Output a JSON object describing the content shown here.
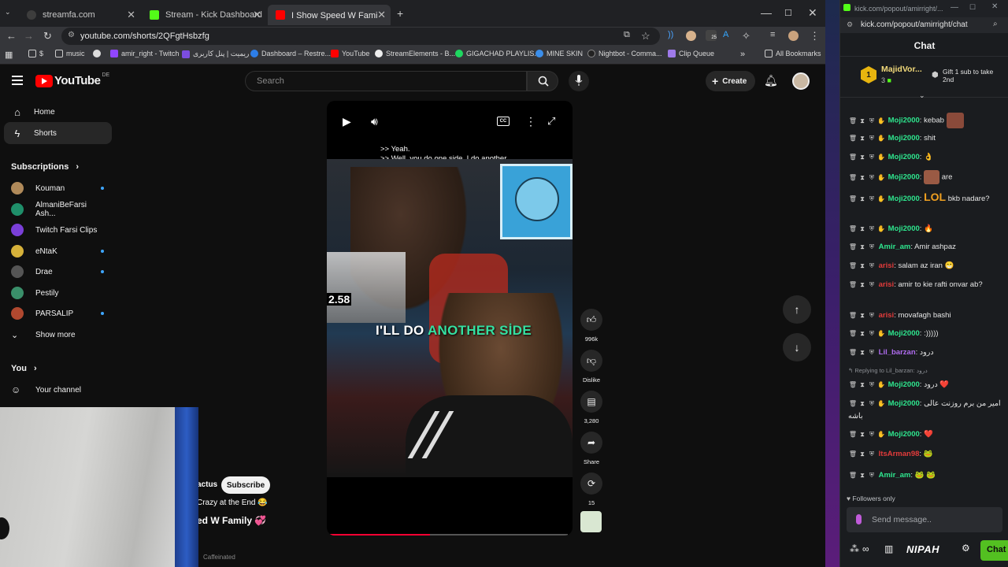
{
  "browser": {
    "tabs": [
      {
        "title": "streamfa.com",
        "color": "#3d3d3d"
      },
      {
        "title": "Stream - Kick Dashboard",
        "color": "#53fc18"
      },
      {
        "title": "I Show Speed W Family 💞 - Yo",
        "color": "#ff0000"
      }
    ],
    "new_tab": "+",
    "url": "youtube.com/shorts/2QFgtHsbzfg",
    "bookmarks": [
      "$",
      "music",
      "amir_right - Twitch",
      "ریمیت | پنل کاربری",
      "Dashboard – Restre...",
      "YouTube",
      "StreamElements - B...",
      "GIGACHAD PLAYLIS...",
      "MINE SKIN",
      "Nightbot - Comma...",
      "Clip Queue"
    ],
    "all_bookmarks": "All Bookmarks",
    "extension_badge": "25"
  },
  "youtube": {
    "logo_text": "YouTube",
    "country": "DE",
    "search_placeholder": "Search",
    "create_label": "Create",
    "sidebar": {
      "home": "Home",
      "shorts": "Shorts",
      "subscriptions_header": "Subscriptions",
      "subscriptions": [
        {
          "name": "Kouman",
          "color": "#b08a5a",
          "dot": true
        },
        {
          "name": "AlmaniBeFarsi Ash...",
          "color": "#1f8f6a",
          "dot": false
        },
        {
          "name": "Twitch Farsi Clips",
          "color": "#7a3fd8",
          "dot": false
        },
        {
          "name": "eNtaK",
          "color": "#d6b13a",
          "dot": true
        },
        {
          "name": "Drae",
          "color": "#555555",
          "dot": true
        },
        {
          "name": "Pestily",
          "color": "#3a8f6a",
          "dot": false
        },
        {
          "name": "PARSALIP",
          "color": "#b0482f",
          "dot": true
        }
      ],
      "show_more": "Show more",
      "you_header": "You",
      "your_channel": "Your channel"
    },
    "short": {
      "subtitle_line1": ">> Yeah.",
      "subtitle_line2": ">> Well, you do one side, I do another",
      "caption_white": "I'LL DO",
      "caption_green": "ANOTHER SİDE",
      "inset_number": "2.58",
      "progress": 0.42,
      "channel_fragment": "actus",
      "subscribe_label": "Subscribe",
      "desc_line": "Crazy at the End 😂",
      "title_fragment": "ed W Family 💞",
      "footer_text": "Caffeinated"
    },
    "actions": {
      "likes": "996k",
      "dislike": "Dislike",
      "comments": "3,280",
      "share": "Share",
      "remix": "15"
    }
  },
  "kick_popout": {
    "window_title": "kick.com/popout/amirright/...",
    "url": "kick.com/popout/amirright/chat",
    "header": "Chat",
    "pinned": {
      "user": "MajidVor...",
      "rank": "1",
      "count": "3",
      "gift_text": "Gift 1 sub to take 2nd"
    },
    "messages": [
      {
        "user": "Moji2000",
        "color": "#2ee68e",
        "text": "kebab",
        "emote": "face"
      },
      {
        "user": "Moji2000",
        "color": "#2ee68e",
        "text": "shit"
      },
      {
        "user": "Moji2000",
        "color": "#2ee68e",
        "text": "",
        "emote": "👌"
      },
      {
        "user": "Moji2000",
        "color": "#2ee68e",
        "text": "are",
        "emote": "face"
      },
      {
        "user": "Moji2000",
        "color": "#2ee68e",
        "text": "bkb nadare?",
        "emote": "LOL"
      },
      {
        "user": "Moji2000",
        "color": "#2ee68e",
        "text": "",
        "emote": "🔥"
      },
      {
        "user": "Amir_am",
        "color": "#2ee68e",
        "text": "Amir ashpaz"
      },
      {
        "user": "arisi",
        "color": "#e23b3b",
        "text": "salam az iran 😁"
      },
      {
        "user": "arisi",
        "color": "#e23b3b",
        "text": "amir to kie rafti onvar ab?"
      },
      {
        "user": "arisi",
        "color": "#e23b3b",
        "text": "movafagh bashi"
      },
      {
        "user": "Moji2000",
        "color": "#2ee68e",
        "text": ":)))))"
      },
      {
        "user": "Lil_barzan",
        "color": "#b06cf0",
        "text": "درود"
      },
      {
        "user": "Moji2000",
        "color": "#2ee68e",
        "text": "درود ❤️"
      },
      {
        "user": "Moji2000",
        "color": "#2ee68e",
        "text": "امیر من برم روزنت عالی باشه"
      },
      {
        "user": "Moji2000",
        "color": "#2ee68e",
        "text": "❤️"
      },
      {
        "user": "ItsArman98",
        "color": "#e23b3b",
        "text": "🐸"
      },
      {
        "user": "Amir_am",
        "color": "#2ee68e",
        "text": "🐸 🐸"
      }
    ],
    "reply_note": "Replying to Lil_barzan: درود",
    "followers_only": "Followers only",
    "send_placeholder": "Send message..",
    "nipah_label": "NIPAH",
    "chat_button": "Chat"
  }
}
